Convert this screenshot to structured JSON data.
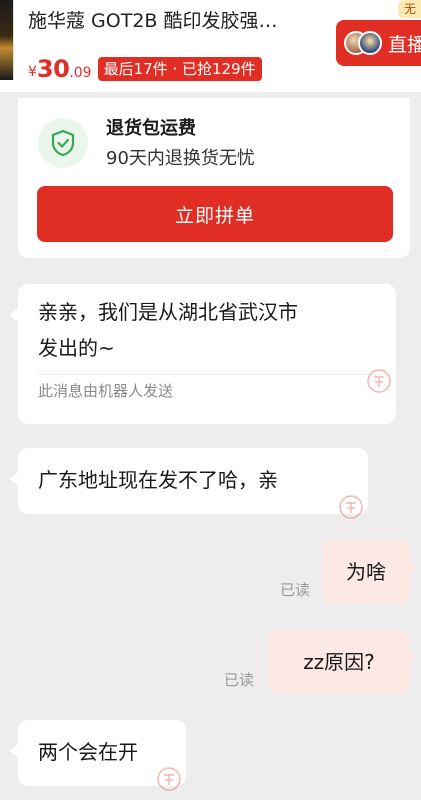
{
  "product": {
    "title": "施华蔻 GOT2B 酷印发胶强…",
    "price_symbol": "¥",
    "price_integer": "30",
    "price_decimal": ".09",
    "stock_badge": "最后17件 · 已抢129件",
    "live_label": "直播",
    "live_tag": "无"
  },
  "return_card": {
    "title": "退货包运费",
    "subtitle": "90天内退换货无忧",
    "button_label": "立即拼单",
    "icon": "shield-check-icon"
  },
  "messages": [
    {
      "side": "left",
      "text": "亲亲，我们是从湖北省武汉市\n发出的~",
      "note": "此消息由机器人发送"
    },
    {
      "side": "left",
      "text": "广东地址现在发不了哈，亲"
    },
    {
      "side": "right",
      "text": "为啥",
      "status": "已读"
    },
    {
      "side": "right",
      "text": "zz原因?",
      "status": "已读"
    },
    {
      "side": "left",
      "text": "两个会在开"
    }
  ],
  "colors": {
    "accent": "#e02e24",
    "background": "#ededed",
    "right_bubble": "#fde9e4",
    "shield_green": "#3aa655"
  }
}
